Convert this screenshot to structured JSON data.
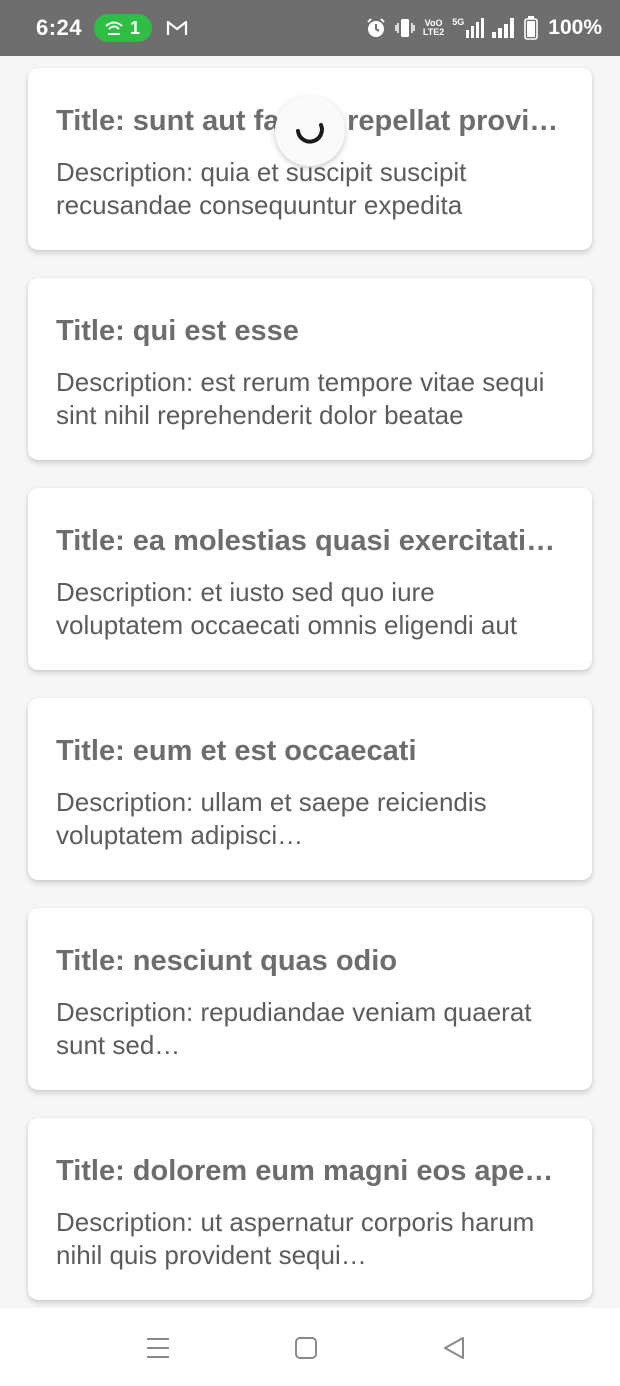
{
  "status_bar": {
    "time": "6:24",
    "hotspot_count": "1",
    "battery": "100%",
    "icons": [
      "hotspot-icon",
      "gmail-icon",
      "alarm-icon",
      "vibrate-icon",
      "volte-icon",
      "5g-signal-icon",
      "signal-icon",
      "battery-icon"
    ],
    "net_label_top": "VoO",
    "net_label_bottom": "LTE2",
    "five_g_label": "5G"
  },
  "loading": {
    "visible": true,
    "icon": "loading-spinner"
  },
  "posts": [
    {
      "title": "Title: sunt aut facere repellat provident",
      "description": "Description: quia et suscipit suscipit recusandae consequuntur expedita"
    },
    {
      "title": "Title: qui est esse",
      "description": "Description: est rerum tempore vitae sequi sint nihil reprehenderit dolor beatae"
    },
    {
      "title": "Title: ea molestias quasi exercitationem",
      "description": "Description: et iusto sed quo iure voluptatem occaecati omnis eligendi aut"
    },
    {
      "title": "Title: eum et est occaecati",
      "description": "Description: ullam et saepe reiciendis voluptatem adipisci…"
    },
    {
      "title": "Title: nesciunt quas odio",
      "description": "Description: repudiandae veniam quaerat sunt sed…"
    },
    {
      "title": "Title: dolorem eum magni eos aperiam",
      "description": "Description: ut aspernatur corporis harum nihil quis provident sequi…"
    }
  ],
  "nav_bar": {
    "buttons": [
      "menu-icon",
      "home-icon",
      "back-icon"
    ]
  }
}
